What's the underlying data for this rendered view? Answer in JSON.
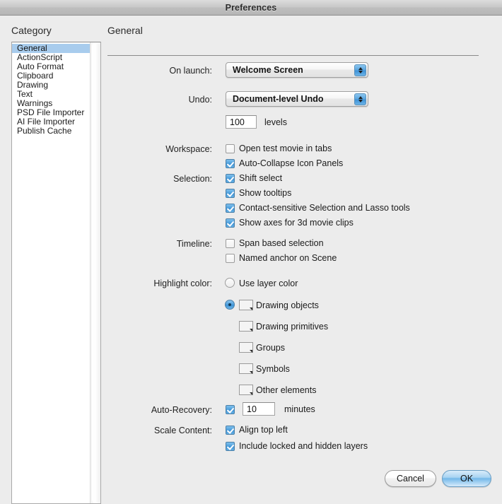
{
  "window": {
    "title": "Preferences"
  },
  "sidebar": {
    "heading": "Category",
    "selected": "General",
    "items": [
      {
        "label": "General"
      },
      {
        "label": "ActionScript"
      },
      {
        "label": "Auto Format"
      },
      {
        "label": "Clipboard"
      },
      {
        "label": "Drawing"
      },
      {
        "label": "Text"
      },
      {
        "label": "Warnings"
      },
      {
        "label": "PSD File Importer"
      },
      {
        "label": "AI File Importer"
      },
      {
        "label": "Publish Cache"
      }
    ]
  },
  "pane": {
    "title": "General"
  },
  "fields": {
    "on_launch": {
      "label": "On launch:",
      "value": "Welcome Screen"
    },
    "undo": {
      "label": "Undo:",
      "value": "Document-level Undo",
      "levels_value": "100",
      "levels_label": "levels"
    },
    "workspace": {
      "label": "Workspace:",
      "options": [
        {
          "label": "Open test movie in tabs",
          "checked": false
        },
        {
          "label": "Auto-Collapse Icon Panels",
          "checked": true
        }
      ]
    },
    "selection": {
      "label": "Selection:",
      "options": [
        {
          "label": "Shift select",
          "checked": true
        },
        {
          "label": "Show tooltips",
          "checked": true
        },
        {
          "label": "Contact-sensitive Selection and Lasso tools",
          "checked": true
        },
        {
          "label": "Show axes for 3d movie clips",
          "checked": true
        }
      ]
    },
    "timeline": {
      "label": "Timeline:",
      "options": [
        {
          "label": "Span based selection",
          "checked": false
        },
        {
          "label": "Named anchor on Scene",
          "checked": false
        }
      ]
    },
    "highlight_color": {
      "label": "Highlight color:",
      "use_layer_color": {
        "label": "Use layer color",
        "selected": false
      },
      "custom": {
        "selected": true
      },
      "swatches": [
        {
          "label": "Drawing objects",
          "color": "#3b39bd"
        },
        {
          "label": "Drawing primitives",
          "color": "#a33bb5"
        },
        {
          "label": "Groups",
          "color": "#3ec59a"
        },
        {
          "label": "Symbols",
          "color": "#4695dd"
        },
        {
          "label": "Other elements",
          "color": "#2f36c0"
        }
      ]
    },
    "auto_recovery": {
      "label": "Auto-Recovery:",
      "checked": true,
      "minutes_value": "10",
      "minutes_label": "minutes"
    },
    "scale_content": {
      "label": "Scale Content:",
      "options": [
        {
          "label": "Align top left",
          "checked": true
        },
        {
          "label": "Include locked and hidden layers",
          "checked": true
        }
      ]
    }
  },
  "buttons": {
    "cancel": "Cancel",
    "ok": "OK"
  }
}
